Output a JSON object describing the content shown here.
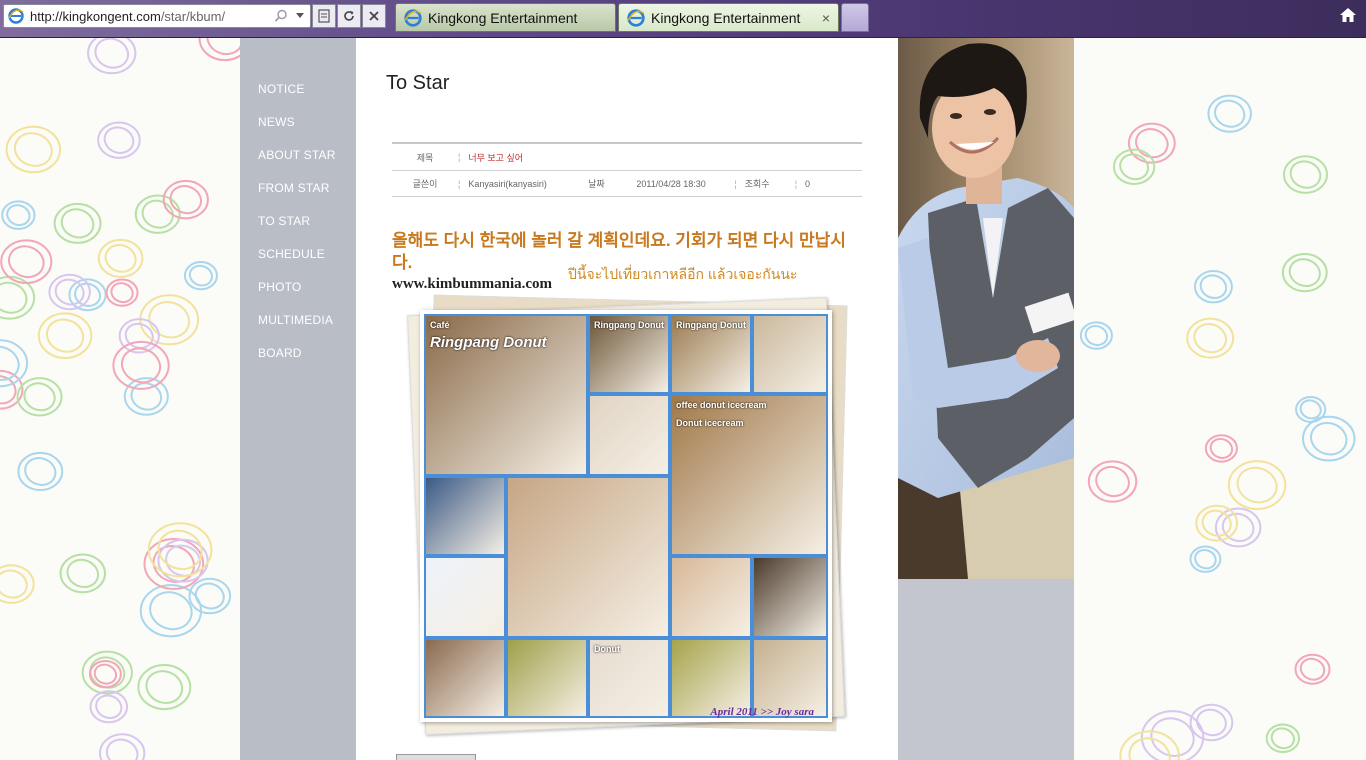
{
  "browser": {
    "address_host": "http://kingkongent.com",
    "address_path": "/star/kbum/",
    "tabs": [
      {
        "label": "Kingkong Entertainment",
        "active": false
      },
      {
        "label": "Kingkong Entertainment",
        "active": true
      }
    ],
    "close_glyph": "×"
  },
  "nav": {
    "items": [
      {
        "label": "NOTICE"
      },
      {
        "label": "NEWS"
      },
      {
        "label": "ABOUT STAR"
      },
      {
        "label": "FROM STAR"
      },
      {
        "label": "TO STAR",
        "current": true
      },
      {
        "label": "SCHEDULE"
      },
      {
        "label": "PHOTO"
      },
      {
        "label": "MULTIMEDIA"
      },
      {
        "label": "BOARD"
      }
    ]
  },
  "post": {
    "page_title": "To Star",
    "subject_label": "제목",
    "subject": "너무 보고 싶어",
    "author_label": "글쓴이",
    "author": "Kanyasiri(kanyasiri)",
    "date_label": "날짜",
    "date": "2011/04/28 18:30",
    "views_label": "조회수",
    "views": "0",
    "message_ko": "올해도 다시 한국에 놀러 갈 계획인데요. 기회가 되면 다시 만납시다.",
    "message_th": "ปีนี้จะไปเที่ยวเกาหลีอีก แล้วเจอะกันนะ",
    "site": "www.kimbummania.com"
  },
  "collage": {
    "tile_texts": [
      "Café",
      "Ringpang Donut",
      "Ringpang Donut",
      "Ringpang Donut",
      "offee donut icecream",
      "Donut icecream",
      "Donut"
    ],
    "caption": "April 2011 >> Joy sara",
    "border_color": "#4a8ed8"
  },
  "colors": {
    "nav_bg": "#b9bdc6",
    "subject": "#c03030",
    "message": "#c8781e"
  }
}
